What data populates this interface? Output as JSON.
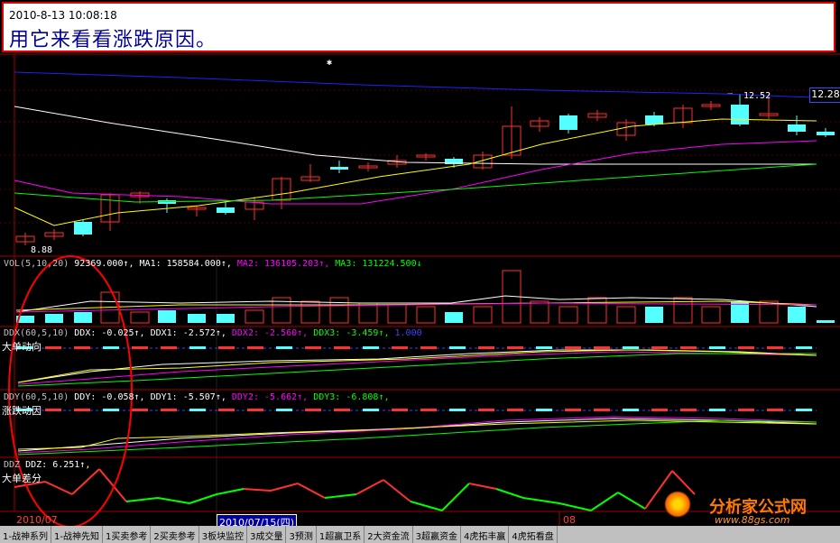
{
  "note": {
    "datetime": "2010-8-13 10:08:18",
    "text": "用它来看看涨跌原因。"
  },
  "price_panel": {
    "high_label": "12.52",
    "low_label": "8.88",
    "last_price": "12.28"
  },
  "vol_panel": {
    "legend": [
      {
        "text": "VOL(5,10,20)",
        "color": "#c0c0c0"
      },
      {
        "text": "92369.000↑,",
        "color": "#ffffff"
      },
      {
        "text": "MA1: 158584.000↑,",
        "color": "#ffffff"
      },
      {
        "text": "MA2: 136105.203↑,",
        "color": "#ff00ff"
      },
      {
        "text": "MA3: 131224.500↓",
        "color": "#00ff00"
      }
    ]
  },
  "ddx_panel": {
    "legend": [
      {
        "text": "DDX(60,5,10)",
        "color": "#c0c0c0"
      },
      {
        "text": "DDX: -0.025↑,",
        "color": "#ffffff"
      },
      {
        "text": "DDX1: -2.572↑,",
        "color": "#ffffff"
      },
      {
        "text": "DDX2: -2.560↑,",
        "color": "#ff00ff"
      },
      {
        "text": "DDX3: -3.459↑,",
        "color": "#00ff00"
      },
      {
        "text": "1.000",
        "color": "#4040ff"
      }
    ],
    "title": "大单动向"
  },
  "ddy_panel": {
    "legend": [
      {
        "text": "DDY(60,5,10)",
        "color": "#c0c0c0"
      },
      {
        "text": "DDY: -0.058↑,",
        "color": "#ffffff"
      },
      {
        "text": "DDY1: -5.507↑,",
        "color": "#ffffff"
      },
      {
        "text": "DDY2: -5.662↑,",
        "color": "#ff00ff"
      },
      {
        "text": "DDY3: -6.808↑,",
        "color": "#00ff00"
      }
    ],
    "title": "涨跌动因"
  },
  "ddz_panel": {
    "legend": [
      {
        "text": "DDZ",
        "color": "#c0c0c0"
      },
      {
        "text": "DDZ: 6.251↑,",
        "color": "#ffffff"
      }
    ],
    "title": "大单差分"
  },
  "time_axis": {
    "left": "2010/07",
    "selected": "2010/07/15(四)",
    "right": "08"
  },
  "watermark": {
    "name": "分析家公式网",
    "url": "www.88gs.com"
  },
  "tabs": [
    "1-战神系列",
    "1-战神先知",
    "1买卖参考",
    "2买卖参考",
    "3板块监控",
    "3成交量",
    "3预测",
    "1超赢卫系",
    "2大资金流",
    "3超赢资金",
    "4虎拓丰赢",
    "4虎拓看盘"
  ],
  "colors": {
    "up": "#ff3030",
    "down": "#54ffff",
    "ma5": "#ffffff",
    "ma10": "#ffff00",
    "ma20": "#ff00ff",
    "ma60": "#00ff00",
    "ma120": "#2020ff"
  }
}
